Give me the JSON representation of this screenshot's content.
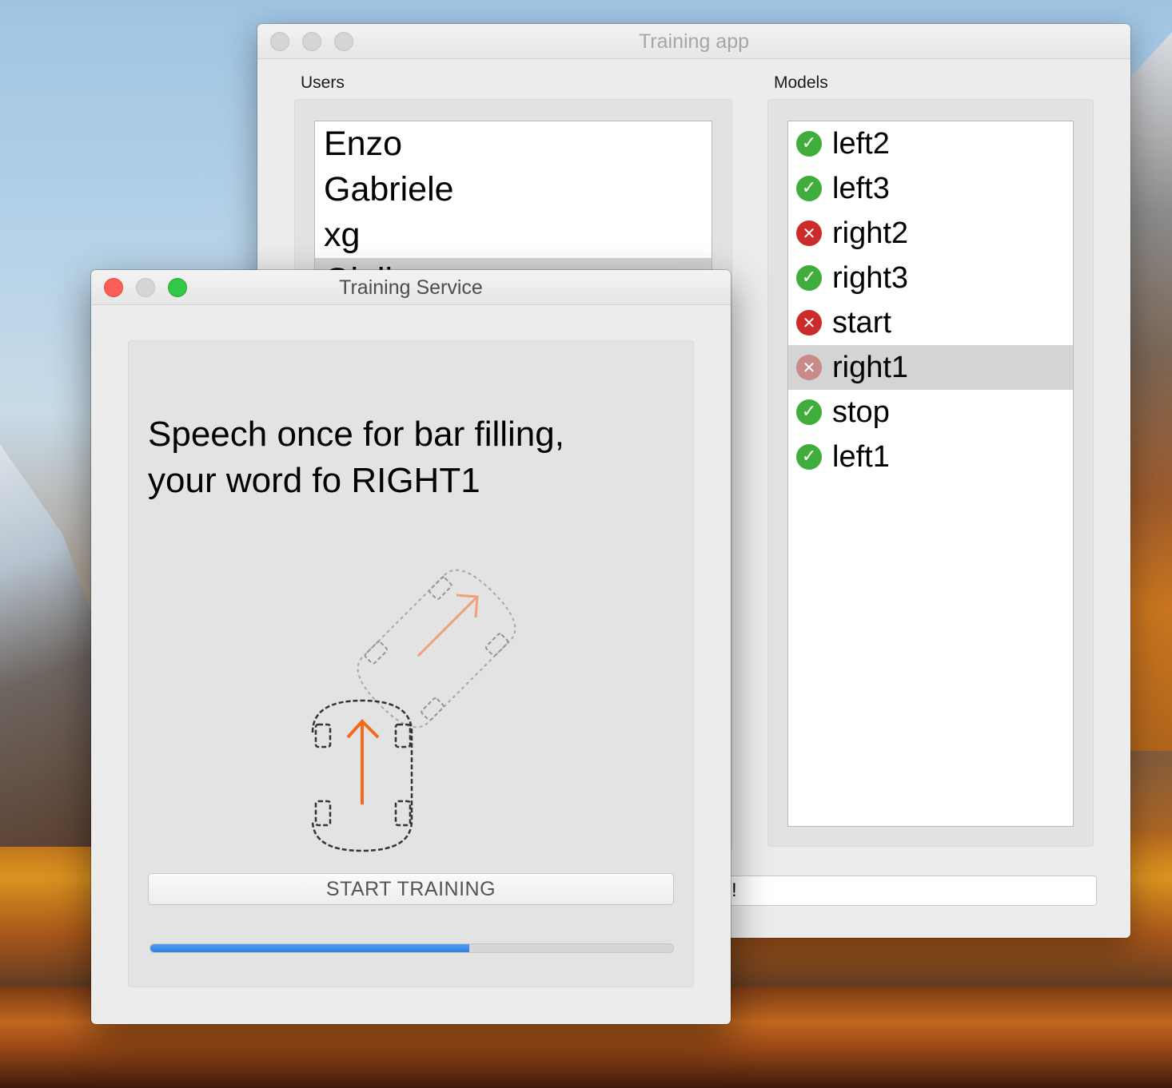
{
  "training_app": {
    "title": "Training app",
    "users_label": "Users",
    "models_label": "Models",
    "users": [
      "Enzo",
      "Gabriele",
      "xg",
      "Giuli"
    ],
    "models": [
      {
        "name": "left2",
        "status": "ok"
      },
      {
        "name": "left3",
        "status": "ok"
      },
      {
        "name": "right2",
        "status": "error"
      },
      {
        "name": "right3",
        "status": "ok"
      },
      {
        "name": "start",
        "status": "error"
      },
      {
        "name": "right1",
        "status": "error",
        "selected": true
      },
      {
        "name": "stop",
        "status": "ok"
      },
      {
        "name": "left1",
        "status": "ok"
      }
    ],
    "status_field_text": "!"
  },
  "training_service": {
    "title": "Training Service",
    "instruction_line1": "Speech once for bar filling,",
    "instruction_line2": "your word fo RIGHT1",
    "start_button": "START TRAINING",
    "progress_fraction": 0.61
  },
  "colors": {
    "accent_progress": "#3a8ae8",
    "ok_icon": "#3fae3c",
    "error_icon": "#cc2b2b",
    "arrow_orange": "#f26a1b"
  },
  "icons": {
    "ok": "check-circle-icon",
    "error": "x-circle-icon"
  }
}
